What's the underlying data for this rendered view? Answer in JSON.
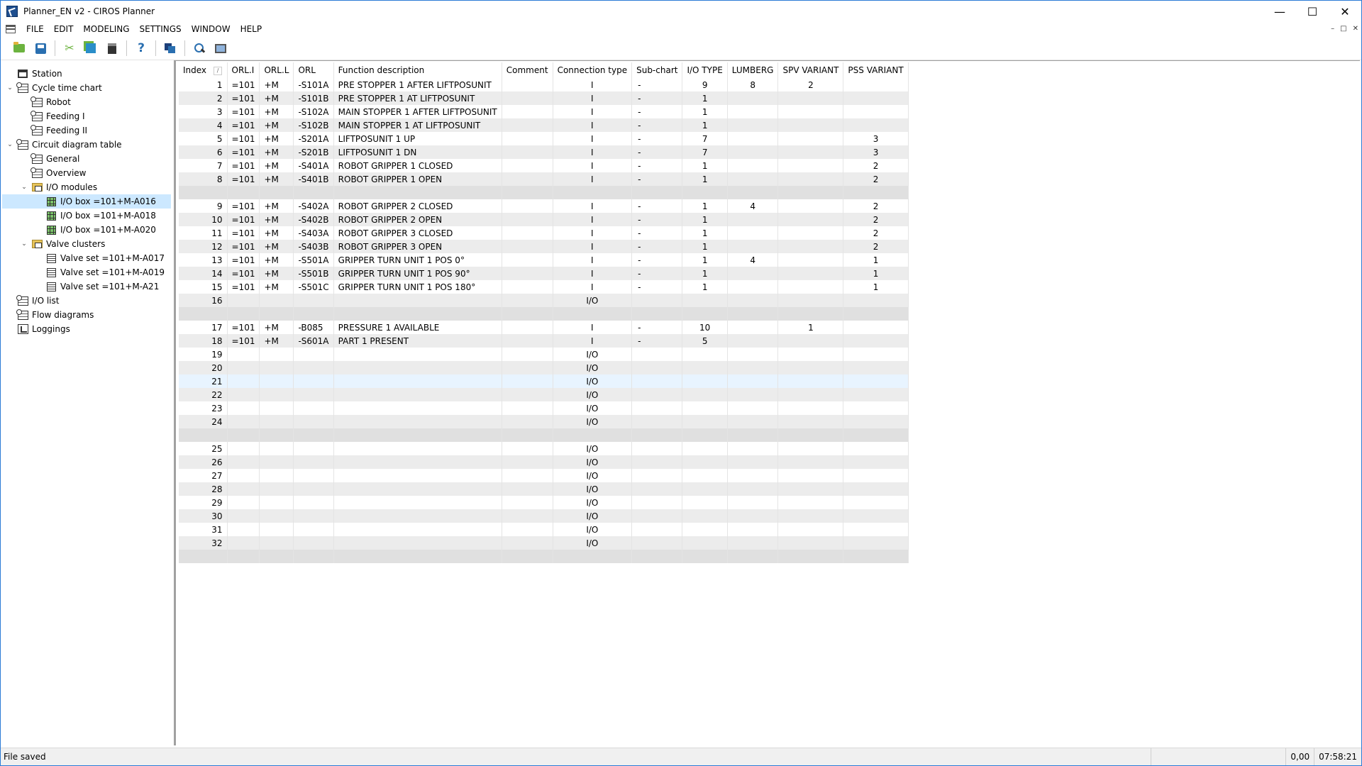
{
  "window": {
    "title": "Planner_EN v2 - CIROS Planner",
    "controls": {
      "minimize": "—",
      "maximize": "☐",
      "close": "✕"
    }
  },
  "menu": {
    "items": [
      "FILE",
      "EDIT",
      "MODELING",
      "SETTINGS",
      "WINDOW",
      "HELP"
    ],
    "mdi_controls": [
      "–",
      "□",
      "✕"
    ]
  },
  "toolbar": {
    "buttons": [
      "open-icon",
      "save-icon",
      "cut-icon",
      "copy-icon",
      "paste-icon",
      "help-icon",
      "window-icon",
      "find-icon",
      "monitor-icon"
    ]
  },
  "tree": {
    "items": [
      {
        "label": "Station",
        "icon": "station-icon",
        "level": 0,
        "expander": ""
      },
      {
        "label": "Cycle time chart",
        "icon": "chart-icon",
        "level": 0,
        "expander": "⌄"
      },
      {
        "label": "Robot",
        "icon": "chart-icon",
        "level": 1,
        "expander": ""
      },
      {
        "label": "Feeding I",
        "icon": "chart-icon",
        "level": 1,
        "expander": ""
      },
      {
        "label": "Feeding II",
        "icon": "chart-icon",
        "level": 1,
        "expander": ""
      },
      {
        "label": "Circuit diagram table",
        "icon": "chart-icon",
        "level": 0,
        "expander": "⌄"
      },
      {
        "label": "General",
        "icon": "chart-icon",
        "level": 1,
        "expander": ""
      },
      {
        "label": "Overview",
        "icon": "chart-icon",
        "level": 1,
        "expander": ""
      },
      {
        "label": "I/O modules",
        "icon": "folder-icon",
        "level": 1,
        "expander": "⌄"
      },
      {
        "label": "I/O box =101+M-A016",
        "icon": "io-box-icon",
        "level": 2,
        "expander": "",
        "selected": true
      },
      {
        "label": "I/O box =101+M-A018",
        "icon": "io-box-icon",
        "level": 2,
        "expander": ""
      },
      {
        "label": "I/O box =101+M-A020",
        "icon": "io-box-icon",
        "level": 2,
        "expander": ""
      },
      {
        "label": "Valve clusters",
        "icon": "folder-icon",
        "level": 1,
        "expander": "⌄"
      },
      {
        "label": "Valve set =101+M-A017",
        "icon": "valve-icon",
        "level": 2,
        "expander": ""
      },
      {
        "label": "Valve set =101+M-A019",
        "icon": "valve-icon",
        "level": 2,
        "expander": ""
      },
      {
        "label": "Valve set =101+M-A21",
        "icon": "valve-icon",
        "level": 2,
        "expander": ""
      },
      {
        "label": "I/O list",
        "icon": "chart-icon",
        "level": 0,
        "expander": ""
      },
      {
        "label": "Flow diagrams",
        "icon": "chart-icon",
        "level": 0,
        "expander": ""
      },
      {
        "label": "Loggings",
        "icon": "flow-icon",
        "level": 0,
        "expander": ""
      }
    ]
  },
  "grid": {
    "sort_indicator": "/",
    "columns": [
      "Index",
      "ORL.I",
      "ORL.L",
      "ORL",
      "Function description",
      "Comment",
      "Connection type",
      "Sub-chart",
      "I/O TYPE",
      "LUMBERG",
      "SPV VARIANT",
      "PSS VARIANT"
    ],
    "rows": [
      [
        "1",
        "=101",
        "+M",
        "-S101A",
        "PRE STOPPER 1 AFTER LIFTPOSUNIT",
        "",
        "I",
        "-",
        "9",
        "8",
        "2",
        ""
      ],
      [
        "2",
        "=101",
        "+M",
        "-S101B",
        "PRE STOPPER 1 AT LIFTPOSUNIT",
        "",
        "I",
        "-",
        "1",
        "",
        "",
        ""
      ],
      [
        "3",
        "=101",
        "+M",
        "-S102A",
        "MAIN STOPPER 1 AFTER LIFTPOSUNIT",
        "",
        "I",
        "-",
        "1",
        "",
        "",
        ""
      ],
      [
        "4",
        "=101",
        "+M",
        "-S102B",
        "MAIN STOPPER 1 AT LIFTPOSUNIT",
        "",
        "I",
        "-",
        "1",
        "",
        "",
        ""
      ],
      [
        "5",
        "=101",
        "+M",
        "-S201A",
        "LIFTPOSUNIT 1 UP",
        "",
        "I",
        "-",
        "7",
        "",
        "",
        "3"
      ],
      [
        "6",
        "=101",
        "+M",
        "-S201B",
        "LIFTPOSUNIT 1 DN",
        "",
        "I",
        "-",
        "7",
        "",
        "",
        "3"
      ],
      [
        "7",
        "=101",
        "+M",
        "-S401A",
        "ROBOT GRIPPER 1 CLOSED",
        "",
        "I",
        "-",
        "1",
        "",
        "",
        "2"
      ],
      [
        "8",
        "=101",
        "+M",
        "-S401B",
        "ROBOT GRIPPER 1 OPEN",
        "",
        "I",
        "-",
        "1",
        "",
        "",
        "2"
      ],
      [
        "",
        "",
        "",
        "",
        "",
        "",
        "",
        "",
        "",
        "",
        "",
        ""
      ],
      [
        "9",
        "=101",
        "+M",
        "-S402A",
        "ROBOT GRIPPER 2 CLOSED",
        "",
        "I",
        "-",
        "1",
        "4",
        "",
        "2"
      ],
      [
        "10",
        "=101",
        "+M",
        "-S402B",
        "ROBOT GRIPPER 2 OPEN",
        "",
        "I",
        "-",
        "1",
        "",
        "",
        "2"
      ],
      [
        "11",
        "=101",
        "+M",
        "-S403A",
        "ROBOT GRIPPER 3 CLOSED",
        "",
        "I",
        "-",
        "1",
        "",
        "",
        "2"
      ],
      [
        "12",
        "=101",
        "+M",
        "-S403B",
        "ROBOT GRIPPER 3 OPEN",
        "",
        "I",
        "-",
        "1",
        "",
        "",
        "2"
      ],
      [
        "13",
        "=101",
        "+M",
        "-S501A",
        "GRIPPER TURN UNIT 1 POS 0°",
        "",
        "I",
        "-",
        "1",
        "4",
        "",
        "1"
      ],
      [
        "14",
        "=101",
        "+M",
        "-S501B",
        "GRIPPER TURN UNIT 1 POS 90°",
        "",
        "I",
        "-",
        "1",
        "",
        "",
        "1"
      ],
      [
        "15",
        "=101",
        "+M",
        "-S501C",
        "GRIPPER TURN UNIT 1 POS 180°",
        "",
        "I",
        "-",
        "1",
        "",
        "",
        "1"
      ],
      [
        "16",
        "",
        "",
        "",
        "",
        "",
        "I/O",
        "",
        "",
        "",
        "",
        ""
      ],
      [
        "",
        "",
        "",
        "",
        "",
        "",
        "",
        "",
        "",
        "",
        "",
        ""
      ],
      [
        "17",
        "=101",
        "+M",
        "-B085",
        "PRESSURE 1 AVAILABLE",
        "",
        "I",
        "-",
        "10",
        "",
        "1",
        ""
      ],
      [
        "18",
        "=101",
        "+M",
        "-S601A",
        "PART 1 PRESENT",
        "",
        "I",
        "-",
        "5",
        "",
        "",
        ""
      ],
      [
        "19",
        "",
        "",
        "",
        "",
        "",
        "I/O",
        "",
        "",
        "",
        "",
        ""
      ],
      [
        "20",
        "",
        "",
        "",
        "",
        "",
        "I/O",
        "",
        "",
        "",
        "",
        ""
      ],
      [
        "21",
        "",
        "",
        "",
        "",
        "",
        "I/O",
        "",
        "",
        "",
        "",
        ""
      ],
      [
        "22",
        "",
        "",
        "",
        "",
        "",
        "I/O",
        "",
        "",
        "",
        "",
        ""
      ],
      [
        "23",
        "",
        "",
        "",
        "",
        "",
        "I/O",
        "",
        "",
        "",
        "",
        ""
      ],
      [
        "24",
        "",
        "",
        "",
        "",
        "",
        "I/O",
        "",
        "",
        "",
        "",
        ""
      ],
      [
        "",
        "",
        "",
        "",
        "",
        "",
        "",
        "",
        "",
        "",
        "",
        ""
      ],
      [
        "25",
        "",
        "",
        "",
        "",
        "",
        "I/O",
        "",
        "",
        "",
        "",
        ""
      ],
      [
        "26",
        "",
        "",
        "",
        "",
        "",
        "I/O",
        "",
        "",
        "",
        "",
        ""
      ],
      [
        "27",
        "",
        "",
        "",
        "",
        "",
        "I/O",
        "",
        "",
        "",
        "",
        ""
      ],
      [
        "28",
        "",
        "",
        "",
        "",
        "",
        "I/O",
        "",
        "",
        "",
        "",
        ""
      ],
      [
        "29",
        "",
        "",
        "",
        "",
        "",
        "I/O",
        "",
        "",
        "",
        "",
        ""
      ],
      [
        "30",
        "",
        "",
        "",
        "",
        "",
        "I/O",
        "",
        "",
        "",
        "",
        ""
      ],
      [
        "31",
        "",
        "",
        "",
        "",
        "",
        "I/O",
        "",
        "",
        "",
        "",
        ""
      ],
      [
        "32",
        "",
        "",
        "",
        "",
        "",
        "I/O",
        "",
        "",
        "",
        "",
        ""
      ],
      [
        "",
        "",
        "",
        "",
        "",
        "",
        "",
        "",
        "",
        "",
        "",
        ""
      ]
    ]
  },
  "status": {
    "message": "File saved",
    "value": "0,00",
    "time": "07:58:21"
  }
}
